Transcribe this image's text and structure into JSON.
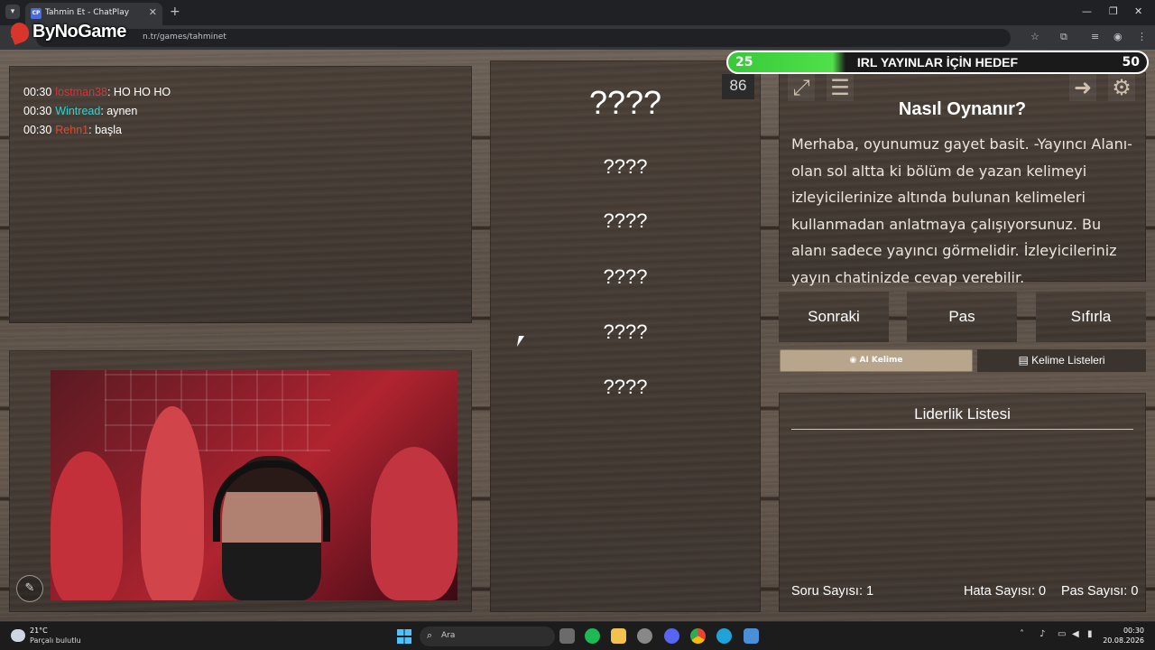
{
  "browser": {
    "tab_title": "Tahmin Et - ChatPlay",
    "tab_favicon": "CP",
    "url": "chatplay.com.tr/games/tahminet",
    "url_visible": "n.tr/games/tahminet"
  },
  "overlay_logo": "ByNoGame",
  "chat": {
    "messages": [
      {
        "time": "00:30",
        "user": "lostman38",
        "user_color": "#d8343c",
        "text": ": HO HO HO"
      },
      {
        "time": "00:30",
        "user": "Wintread",
        "user_color": "#2fd3d0",
        "text": ": aynen"
      },
      {
        "time": "00:30",
        "user": "Rehn1",
        "user_color": "#e0482b",
        "text": ": başla"
      }
    ]
  },
  "words": {
    "main": "????",
    "forbidden": [
      "????",
      "????",
      "????",
      "????",
      "????"
    ]
  },
  "target_bar": {
    "current": "25",
    "label": "IRL YAYINLAR İÇİN HEDEF",
    "goal": "50",
    "progress_percent": 27
  },
  "timer": "86",
  "howto": {
    "title": "Nasıl Oynanır?",
    "text": "Merhaba, oyunumuz gayet basit. -Yayıncı Alanı- olan sol altta ki bölüm de yazan kelimeyi izleyicilerinize altında bulunan kelimeleri kullanmadan anlatmaya çalışıyorsunuz. Bu alanı sadece yayıncı görmelidir. İzleyicileriniz yayın chatinizde cevap verebilir."
  },
  "actions": {
    "next": "Sonraki",
    "pass": "Pas",
    "reset": "Sıfırla"
  },
  "ai_word_label": "AI Kelime",
  "word_lists_label": "Kelime Listeleri",
  "leaderboard": {
    "title": "Liderlik Listesi",
    "question_count": "Soru Sayısı: 1",
    "error_count": "Hata Sayısı: 0",
    "pass_count": "Pas Sayısı: 0"
  },
  "taskbar": {
    "weather_temp": "21°C",
    "weather_desc": "Parçalı bulutlu",
    "search_placeholder": "Ara",
    "time": "00:30",
    "date": "20.08.2026"
  }
}
